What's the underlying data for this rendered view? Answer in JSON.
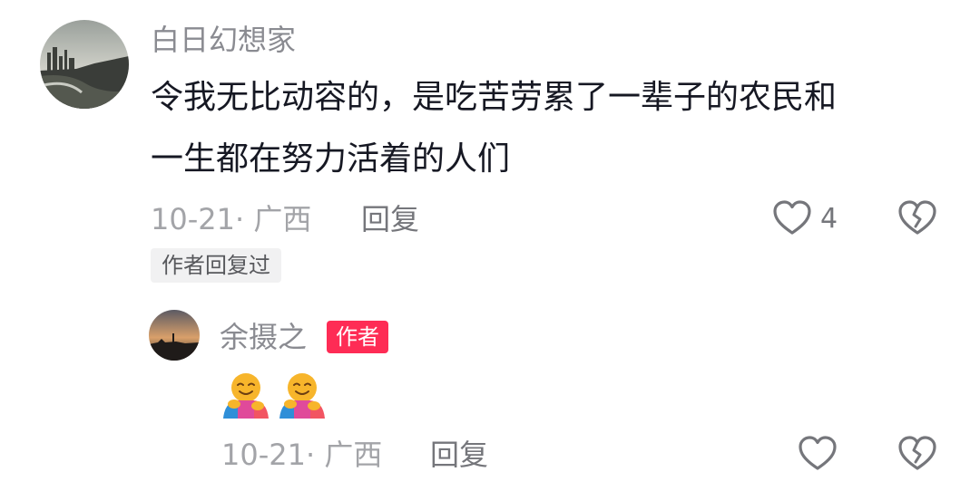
{
  "comment": {
    "username": "白日幻想家",
    "text_line1": "令我无比动容的，是吃苦劳累了一辈子的农民和",
    "text_line2": "一生都在努力活着的人们",
    "meta": "10-21· 广西",
    "reply_label": "回复",
    "like_count": "4",
    "author_replied_badge": "作者回复过"
  },
  "reply": {
    "username": "余摄之",
    "author_badge": "作者",
    "emojis": [
      "people-hugging-emoji",
      "people-hugging-emoji"
    ],
    "meta": "10-21· 广西",
    "reply_label": "回复"
  },
  "colors": {
    "accent": "#fe2c55",
    "text_primary": "#161823",
    "text_secondary": "#8a8b91",
    "text_meta": "#a3a4a8"
  },
  "icons": {
    "like": "heart-outline-icon",
    "dislike": "broken-heart-icon"
  }
}
